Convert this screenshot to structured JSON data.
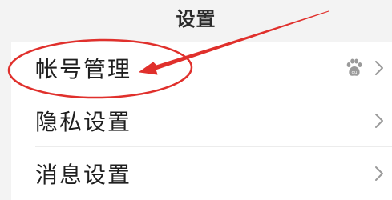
{
  "header": {
    "title": "设置"
  },
  "settings": {
    "items": [
      {
        "label": "帐号管理",
        "badge_icon": "baidu-paw-icon",
        "chevron_icon": "chevron-right-icon"
      },
      {
        "label": "隐私设置",
        "chevron_icon": "chevron-right-icon"
      },
      {
        "label": "消息设置",
        "chevron_icon": "chevron-right-icon"
      }
    ]
  },
  "annotation": {
    "color": "#e0302c",
    "shape": "ellipse-with-arrow",
    "target": "帐号管理"
  }
}
